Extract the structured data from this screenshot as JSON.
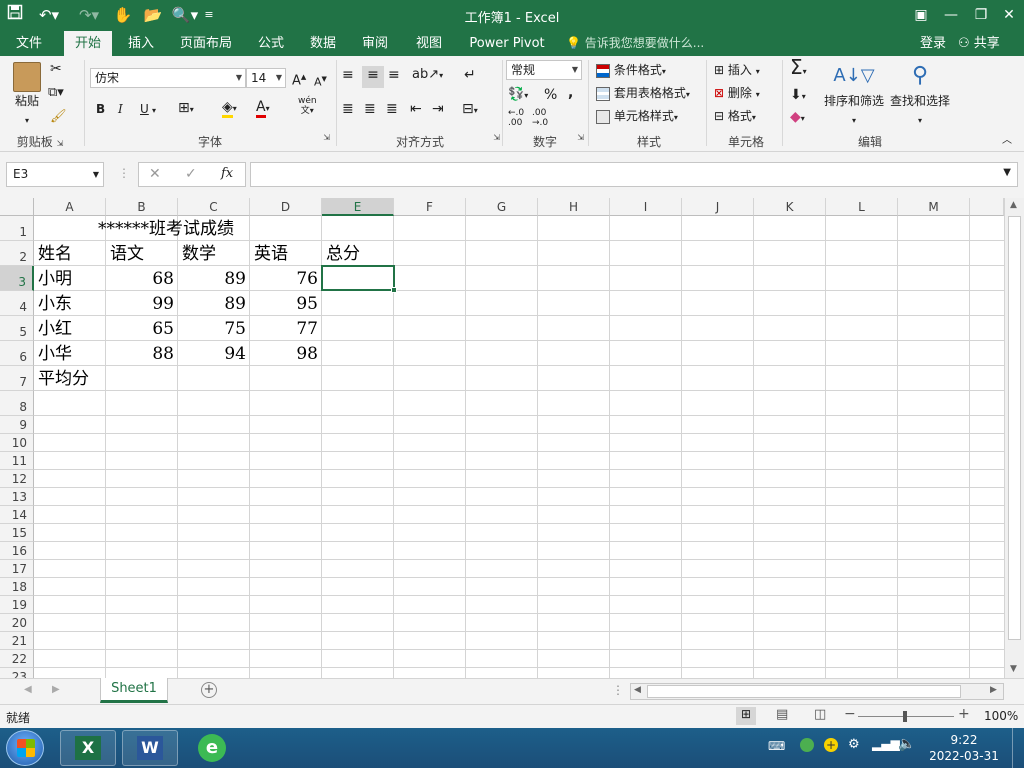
{
  "window": {
    "title": "工作簿1 - Excel"
  },
  "quick_access": {
    "save": "save-icon",
    "undo": "undo-icon",
    "redo": "redo-icon"
  },
  "tabs": [
    "文件",
    "开始",
    "插入",
    "页面布局",
    "公式",
    "数据",
    "审阅",
    "视图",
    "Power Pivot"
  ],
  "tell_me": "告诉我您想要做什么...",
  "account": {
    "login": "登录",
    "share": "共享"
  },
  "ribbon": {
    "clipboard": {
      "paste": "粘贴",
      "label": "剪贴板"
    },
    "font": {
      "name": "仿宋",
      "size": "14",
      "bold": "B",
      "italic": "I",
      "underline": "U",
      "label": "字体",
      "phonetic": "wén"
    },
    "alignment": {
      "label": "对齐方式"
    },
    "number": {
      "format": "常规",
      "percent": "%",
      "comma": ",",
      "label": "数字"
    },
    "styles": {
      "conditional": "条件格式",
      "table": "套用表格格式",
      "cell": "单元格样式",
      "label": "样式"
    },
    "cells": {
      "insert": "插入",
      "delete": "删除",
      "format": "格式",
      "label": "单元格"
    },
    "editing": {
      "sort": "排序和筛选",
      "find": "查找和选择",
      "label": "编辑"
    }
  },
  "formula_bar": {
    "name_box": "E3",
    "fx": "fx",
    "content": ""
  },
  "columns": [
    "A",
    "B",
    "C",
    "D",
    "E",
    "F",
    "G",
    "H",
    "I",
    "J",
    "K",
    "L",
    "M"
  ],
  "rows": [
    "1",
    "2",
    "3",
    "4",
    "5",
    "6",
    "7",
    "8",
    "9",
    "10",
    "11",
    "12",
    "13",
    "14",
    "15",
    "16",
    "17",
    "18",
    "19",
    "20",
    "21",
    "22",
    "23"
  ],
  "sheet": {
    "title": "******班考试成绩",
    "headers": [
      "姓名",
      "语文",
      "数学",
      "英语",
      "总分"
    ],
    "data": [
      {
        "name": "小明",
        "chinese": "68",
        "math": "89",
        "english": "76"
      },
      {
        "name": "小东",
        "chinese": "99",
        "math": "89",
        "english": "95"
      },
      {
        "name": "小红",
        "chinese": "65",
        "math": "75",
        "english": "77"
      },
      {
        "name": "小华",
        "chinese": "88",
        "math": "94",
        "english": "98"
      }
    ],
    "average_label": "平均分",
    "selected_cell": "E3"
  },
  "sheet_tabs": {
    "active": "Sheet1"
  },
  "status": {
    "ready": "就绪",
    "zoom": "100%"
  },
  "taskbar": {
    "time": "9:22",
    "date": "2022-03-31"
  },
  "colors": {
    "excel_green": "#217346",
    "selection": "#217346"
  }
}
